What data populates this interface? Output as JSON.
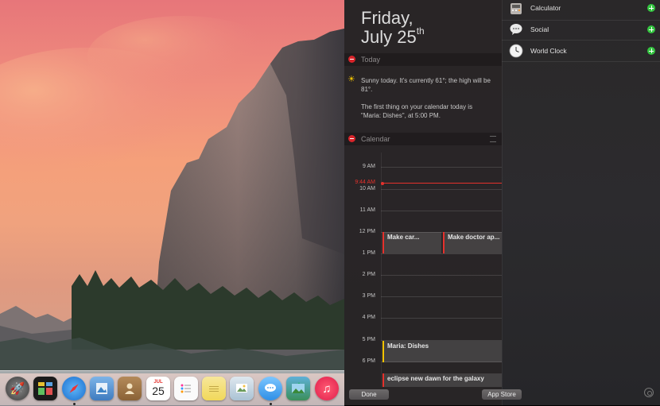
{
  "date": {
    "weekday": "Friday,",
    "month_day": "July 25",
    "suffix": "th"
  },
  "today_section": {
    "title": "Today",
    "weather": "Sunny today. It's currently 61°; the high will be 81°.",
    "calendar_summary": "The first thing on your calendar today is \"Maria: Dishes\", at 5:00 PM."
  },
  "calendar_section": {
    "title": "Calendar",
    "current_time": "9:44 AM",
    "hours": [
      "9 AM",
      "10 AM",
      "11 AM",
      "12 PM",
      "1 PM",
      "2 PM",
      "3 PM",
      "4 PM",
      "5 PM",
      "6 PM"
    ],
    "events": [
      {
        "title": "Make car...",
        "color": "#e5312c"
      },
      {
        "title": "Make doctor ap...",
        "color": "#e5312c"
      },
      {
        "title": "Maria: Dishes",
        "color": "#f5c400"
      },
      {
        "title": "eclipse new dawn for the galaxy",
        "color": "#e5312c"
      }
    ]
  },
  "widgets": [
    {
      "label": "Calculator",
      "icon": "calculator-icon"
    },
    {
      "label": "Social",
      "icon": "speech-bubble-icon"
    },
    {
      "label": "World Clock",
      "icon": "clock-icon"
    }
  ],
  "buttons": {
    "done": "Done",
    "app_store": "App Store"
  },
  "dock": {
    "apps": [
      "launchpad",
      "dashboard",
      "safari",
      "preview",
      "contacts",
      "calendar",
      "reminders",
      "notes",
      "photos",
      "messages",
      "iphoto",
      "itunes"
    ],
    "calendar_badge_month": "JUL",
    "calendar_badge_day": "25"
  },
  "colors": {
    "accent_red": "#e5312c",
    "add_green": "#34c540",
    "panel_bg": "#2e2b2c"
  }
}
